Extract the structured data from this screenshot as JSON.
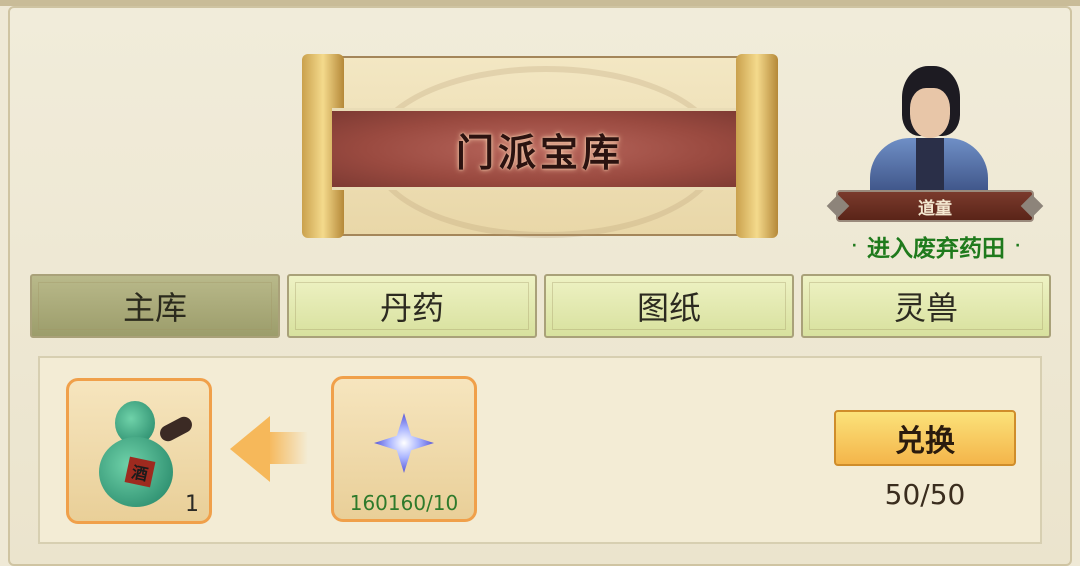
{
  "banner": {
    "title": "门派宝库"
  },
  "npc": {
    "name": "道童",
    "link_label": "进入废弃药田",
    "link_prefix": "·",
    "link_suffix": "·"
  },
  "tabs": [
    {
      "label": "主库",
      "active": true
    },
    {
      "label": "丹药",
      "active": false
    },
    {
      "label": "图纸",
      "active": false
    },
    {
      "label": "灵兽",
      "active": false
    }
  ],
  "reward": {
    "count": "1",
    "icon": "gourd-icon",
    "label_glyph": "酒"
  },
  "cost": {
    "amount": "160160/10",
    "icon": "crystal-icon"
  },
  "exchange": {
    "button_label": "兑换",
    "remaining": "50/50"
  },
  "colors": {
    "accent": "#f4b54a",
    "link_green": "#1f7a1c",
    "ribbon": "#9a4a40",
    "slot_border": "#f0a04a"
  }
}
